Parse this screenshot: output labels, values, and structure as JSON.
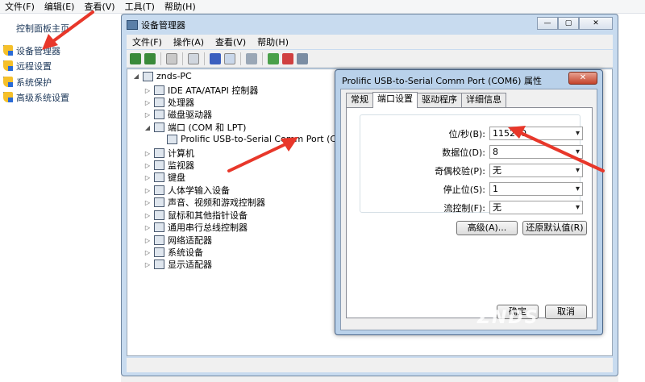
{
  "outer_menu": [
    "文件(F)",
    "编辑(E)",
    "查看(V)",
    "工具(T)",
    "帮助(H)"
  ],
  "left_panel": {
    "home": "控制面板主页",
    "items": [
      "设备管理器",
      "远程设置",
      "系统保护",
      "高级系统设置"
    ]
  },
  "device_manager": {
    "title": "设备管理器",
    "menu": [
      "文件(F)",
      "操作(A)",
      "查看(V)",
      "帮助(H)"
    ],
    "window_buttons": [
      "—",
      "▢",
      "✕"
    ],
    "tree": {
      "root": "znds-PC",
      "nodes": [
        {
          "label": "IDE ATA/ATAPI 控制器",
          "expander": "▷"
        },
        {
          "label": "处理器",
          "expander": "▷"
        },
        {
          "label": "磁盘驱动器",
          "expander": "▷"
        },
        {
          "label": "端口 (COM 和 LPT)",
          "expander": "◢"
        },
        {
          "label": "Prolific USB-to-Serial Comm Port (COM6)",
          "expander": ""
        },
        {
          "label": "计算机",
          "expander": "▷"
        },
        {
          "label": "监视器",
          "expander": "▷"
        },
        {
          "label": "键盘",
          "expander": "▷"
        },
        {
          "label": "人体学输入设备",
          "expander": "▷"
        },
        {
          "label": "声音、视频和游戏控制器",
          "expander": "▷"
        },
        {
          "label": "鼠标和其他指针设备",
          "expander": "▷"
        },
        {
          "label": "通用串行总线控制器",
          "expander": "▷"
        },
        {
          "label": "网络适配器",
          "expander": "▷"
        },
        {
          "label": "系统设备",
          "expander": "▷"
        },
        {
          "label": "显示适配器",
          "expander": "▷"
        }
      ]
    }
  },
  "properties": {
    "title": "Prolific USB-to-Serial Comm Port (COM6) 属性",
    "close": "✕",
    "tabs": [
      "常规",
      "端口设置",
      "驱动程序",
      "详细信息"
    ],
    "fields": [
      {
        "label": "位/秒(B):",
        "value": "115200"
      },
      {
        "label": "数据位(D):",
        "value": "8"
      },
      {
        "label": "奇偶校验(P):",
        "value": "无"
      },
      {
        "label": "停止位(S):",
        "value": "1"
      },
      {
        "label": "流控制(F):",
        "value": "无"
      }
    ],
    "advanced_button": "高级(A)...",
    "restore_button": "还原默认值(R)",
    "ok_button": "确定",
    "cancel_button": "取消"
  },
  "watermark": "ZNDS"
}
